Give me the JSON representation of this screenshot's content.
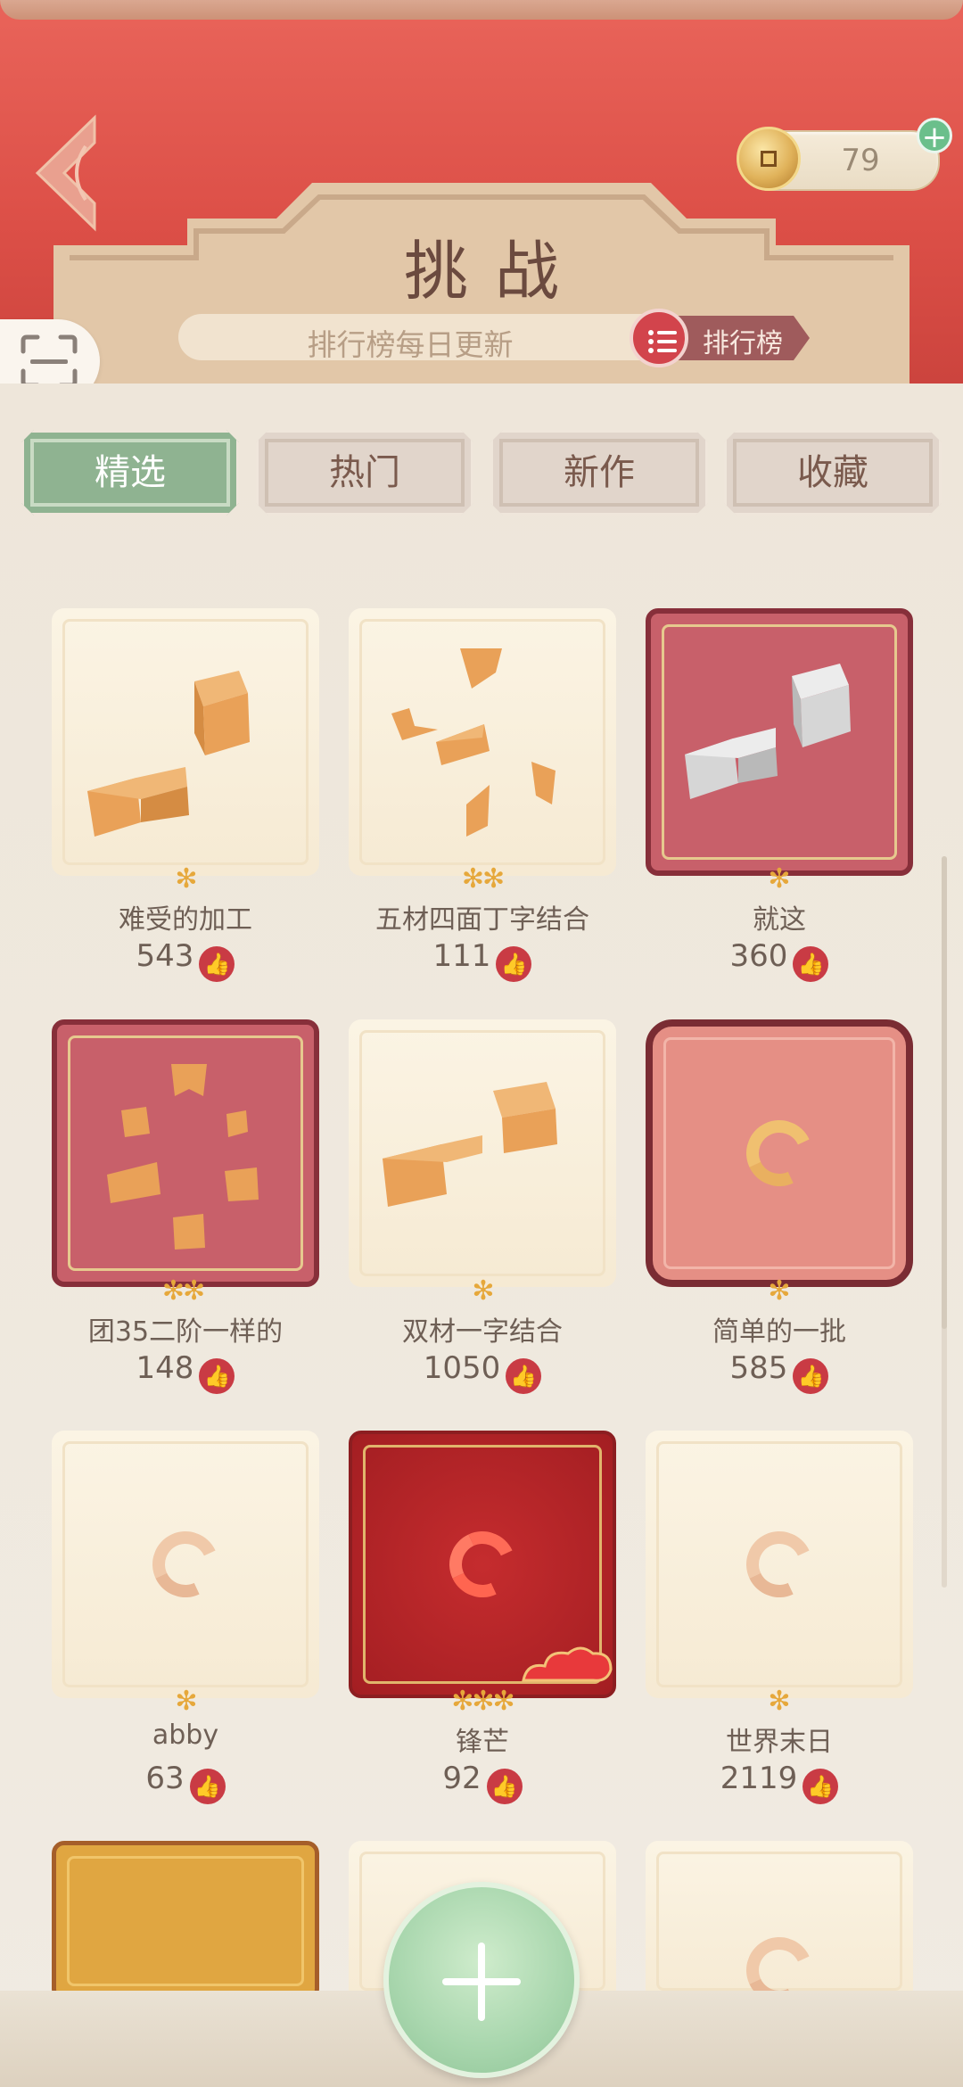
{
  "header": {
    "title": "挑战",
    "notice": "排行榜每日更新",
    "rank_label": "排行榜",
    "coins": "79"
  },
  "tabs": [
    {
      "label": "精选",
      "active": true
    },
    {
      "label": "热门",
      "active": false
    },
    {
      "label": "新作",
      "active": false
    },
    {
      "label": "收藏",
      "active": false
    }
  ],
  "puzzles": [
    {
      "name": "难受的加工",
      "likes": "543",
      "stars": "✻",
      "style": "cream"
    },
    {
      "name": "五材四面丁字结合",
      "likes": "111",
      "stars": "✻✻",
      "style": "cream"
    },
    {
      "name": "就这",
      "likes": "360",
      "stars": "✻",
      "style": "maroon"
    },
    {
      "name": "团35二阶一样的",
      "likes": "148",
      "stars": "✻✻",
      "style": "maroon"
    },
    {
      "name": "双材一字结合",
      "likes": "1050",
      "stars": "✻",
      "style": "cream"
    },
    {
      "name": "简单的一批",
      "likes": "585",
      "stars": "✻",
      "style": "salmon"
    },
    {
      "name": "abby",
      "likes": "63",
      "stars": "✻",
      "style": "cream"
    },
    {
      "name": "锋芒",
      "likes": "92",
      "stars": "✻✻✻",
      "style": "red"
    },
    {
      "name": "世界末日",
      "likes": "2119",
      "stars": "✻",
      "style": "cream"
    }
  ],
  "icons": {
    "back": "back-arrow-icon",
    "scan": "scan-icon",
    "rank": "list-icon",
    "coin": "coin-icon",
    "like": "thumbs-up-icon",
    "add": "plus-icon"
  },
  "colors": {
    "header_red": "#dc4f47",
    "tab_active": "#8fb391",
    "like_red": "#c93b44",
    "wood": "#e2c7a8"
  }
}
